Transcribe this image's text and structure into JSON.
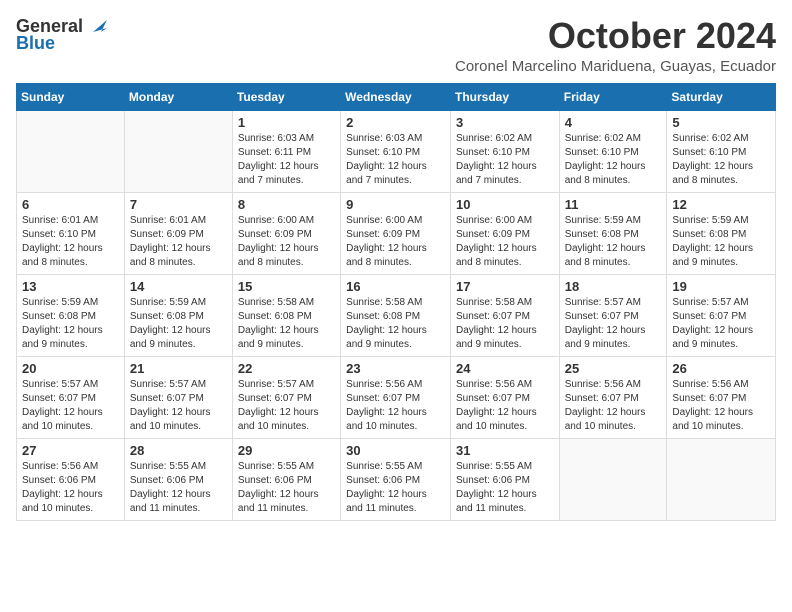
{
  "logo": {
    "general": "General",
    "blue": "Blue"
  },
  "title": {
    "month": "October 2024",
    "location": "Coronel Marcelino Mariduena, Guayas, Ecuador"
  },
  "weekdays": [
    "Sunday",
    "Monday",
    "Tuesday",
    "Wednesday",
    "Thursday",
    "Friday",
    "Saturday"
  ],
  "weeks": [
    [
      {
        "day": "",
        "info": ""
      },
      {
        "day": "",
        "info": ""
      },
      {
        "day": "1",
        "info": "Sunrise: 6:03 AM\nSunset: 6:11 PM\nDaylight: 12 hours and 7 minutes."
      },
      {
        "day": "2",
        "info": "Sunrise: 6:03 AM\nSunset: 6:10 PM\nDaylight: 12 hours and 7 minutes."
      },
      {
        "day": "3",
        "info": "Sunrise: 6:02 AM\nSunset: 6:10 PM\nDaylight: 12 hours and 7 minutes."
      },
      {
        "day": "4",
        "info": "Sunrise: 6:02 AM\nSunset: 6:10 PM\nDaylight: 12 hours and 8 minutes."
      },
      {
        "day": "5",
        "info": "Sunrise: 6:02 AM\nSunset: 6:10 PM\nDaylight: 12 hours and 8 minutes."
      }
    ],
    [
      {
        "day": "6",
        "info": "Sunrise: 6:01 AM\nSunset: 6:10 PM\nDaylight: 12 hours and 8 minutes."
      },
      {
        "day": "7",
        "info": "Sunrise: 6:01 AM\nSunset: 6:09 PM\nDaylight: 12 hours and 8 minutes."
      },
      {
        "day": "8",
        "info": "Sunrise: 6:00 AM\nSunset: 6:09 PM\nDaylight: 12 hours and 8 minutes."
      },
      {
        "day": "9",
        "info": "Sunrise: 6:00 AM\nSunset: 6:09 PM\nDaylight: 12 hours and 8 minutes."
      },
      {
        "day": "10",
        "info": "Sunrise: 6:00 AM\nSunset: 6:09 PM\nDaylight: 12 hours and 8 minutes."
      },
      {
        "day": "11",
        "info": "Sunrise: 5:59 AM\nSunset: 6:08 PM\nDaylight: 12 hours and 8 minutes."
      },
      {
        "day": "12",
        "info": "Sunrise: 5:59 AM\nSunset: 6:08 PM\nDaylight: 12 hours and 9 minutes."
      }
    ],
    [
      {
        "day": "13",
        "info": "Sunrise: 5:59 AM\nSunset: 6:08 PM\nDaylight: 12 hours and 9 minutes."
      },
      {
        "day": "14",
        "info": "Sunrise: 5:59 AM\nSunset: 6:08 PM\nDaylight: 12 hours and 9 minutes."
      },
      {
        "day": "15",
        "info": "Sunrise: 5:58 AM\nSunset: 6:08 PM\nDaylight: 12 hours and 9 minutes."
      },
      {
        "day": "16",
        "info": "Sunrise: 5:58 AM\nSunset: 6:08 PM\nDaylight: 12 hours and 9 minutes."
      },
      {
        "day": "17",
        "info": "Sunrise: 5:58 AM\nSunset: 6:07 PM\nDaylight: 12 hours and 9 minutes."
      },
      {
        "day": "18",
        "info": "Sunrise: 5:57 AM\nSunset: 6:07 PM\nDaylight: 12 hours and 9 minutes."
      },
      {
        "day": "19",
        "info": "Sunrise: 5:57 AM\nSunset: 6:07 PM\nDaylight: 12 hours and 9 minutes."
      }
    ],
    [
      {
        "day": "20",
        "info": "Sunrise: 5:57 AM\nSunset: 6:07 PM\nDaylight: 12 hours and 10 minutes."
      },
      {
        "day": "21",
        "info": "Sunrise: 5:57 AM\nSunset: 6:07 PM\nDaylight: 12 hours and 10 minutes."
      },
      {
        "day": "22",
        "info": "Sunrise: 5:57 AM\nSunset: 6:07 PM\nDaylight: 12 hours and 10 minutes."
      },
      {
        "day": "23",
        "info": "Sunrise: 5:56 AM\nSunset: 6:07 PM\nDaylight: 12 hours and 10 minutes."
      },
      {
        "day": "24",
        "info": "Sunrise: 5:56 AM\nSunset: 6:07 PM\nDaylight: 12 hours and 10 minutes."
      },
      {
        "day": "25",
        "info": "Sunrise: 5:56 AM\nSunset: 6:07 PM\nDaylight: 12 hours and 10 minutes."
      },
      {
        "day": "26",
        "info": "Sunrise: 5:56 AM\nSunset: 6:07 PM\nDaylight: 12 hours and 10 minutes."
      }
    ],
    [
      {
        "day": "27",
        "info": "Sunrise: 5:56 AM\nSunset: 6:06 PM\nDaylight: 12 hours and 10 minutes."
      },
      {
        "day": "28",
        "info": "Sunrise: 5:55 AM\nSunset: 6:06 PM\nDaylight: 12 hours and 11 minutes."
      },
      {
        "day": "29",
        "info": "Sunrise: 5:55 AM\nSunset: 6:06 PM\nDaylight: 12 hours and 11 minutes."
      },
      {
        "day": "30",
        "info": "Sunrise: 5:55 AM\nSunset: 6:06 PM\nDaylight: 12 hours and 11 minutes."
      },
      {
        "day": "31",
        "info": "Sunrise: 5:55 AM\nSunset: 6:06 PM\nDaylight: 12 hours and 11 minutes."
      },
      {
        "day": "",
        "info": ""
      },
      {
        "day": "",
        "info": ""
      }
    ]
  ]
}
